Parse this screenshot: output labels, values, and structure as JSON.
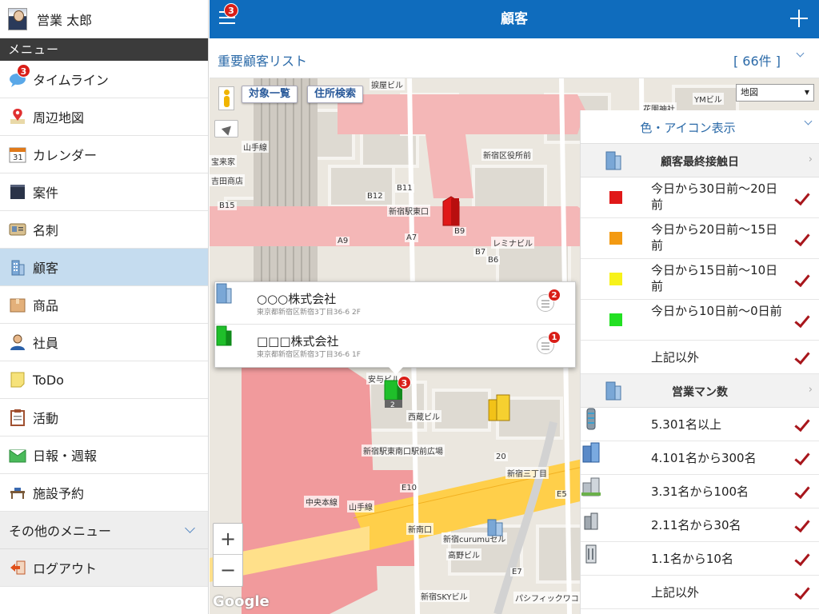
{
  "user": {
    "name": "営業 太郎"
  },
  "sidebar": {
    "menu_header": "メニュー",
    "items": [
      {
        "label": "タイムライン",
        "badge": "3",
        "icon": "chat-bubble-icon"
      },
      {
        "label": "周辺地図",
        "icon": "map-pin-icon"
      },
      {
        "label": "カレンダー",
        "icon": "calendar-icon"
      },
      {
        "label": "案件",
        "icon": "case-icon"
      },
      {
        "label": "名刺",
        "icon": "business-card-icon"
      },
      {
        "label": "顧客",
        "icon": "building-icon",
        "active": true
      },
      {
        "label": "商品",
        "icon": "box-icon"
      },
      {
        "label": "社員",
        "icon": "person-icon"
      },
      {
        "label": "ToDo",
        "icon": "note-icon"
      },
      {
        "label": "活動",
        "icon": "clipboard-icon"
      },
      {
        "label": "日報・週報",
        "icon": "report-icon"
      },
      {
        "label": "施設予約",
        "icon": "facility-icon"
      }
    ],
    "more_menu": "その他のメニュー",
    "logout": "ログアウト"
  },
  "header": {
    "title": "顧客",
    "badge": "3"
  },
  "subheader": {
    "list_name": "重要顧客リスト",
    "count": "[ 66件 ]"
  },
  "map": {
    "buttons": {
      "target_list": "対象一覧",
      "address_search": "住所検索"
    },
    "map_type": "地図",
    "zoom_in": "+",
    "zoom_out": "−",
    "attribution": "Google",
    "labels": {
      "l1": "新宿区役所前",
      "l2": "新宿駅東口",
      "l3": "レミナビル",
      "l4": "山手線",
      "l5": "宝来家",
      "l6": "吉田商店",
      "l7": "新宿駅東南口駅前広場",
      "l8": "新宿三丁目",
      "l9": "中央本線",
      "l10": "山手線",
      "l11": "新南口",
      "l12": "新宿curumuセル",
      "l13": "高野ビル",
      "l14": "新宿SKYビル",
      "l15": "パシフィックワコ",
      "l16": "西蔵ビル",
      "l17": "安与ビル",
      "l18": "YMビル",
      "l19": "花園神社",
      "l20": "捩屋ビル",
      "l21": "B12",
      "l22": "B11",
      "l23": "B15",
      "l24": "A9",
      "l25": "A7",
      "l26": "B9",
      "l27": "B7",
      "l28": "B6",
      "l29": "E10",
      "l30": "E5",
      "l31": "E7",
      "l32": "20",
      "l33": "2"
    },
    "marker_badge": "3",
    "popup": [
      {
        "name": "○○○株式会社",
        "address": "東京都新宿区新宿3丁目36-6 2F",
        "badge": "2",
        "color": "#7aa7d6"
      },
      {
        "name": "□□□株式会社",
        "address": "東京都新宿区新宿3丁目36-6 1F",
        "badge": "1",
        "color": "#1fbf2a"
      }
    ]
  },
  "legend": {
    "title": "色・アイコン表示",
    "section1": {
      "title": "顧客最終接触日",
      "rows": [
        {
          "label": "今日から30日前〜20日前",
          "color": "#e01818"
        },
        {
          "label": "今日から20日前〜15日前",
          "color": "#f39a12"
        },
        {
          "label": "今日から15日前〜10日前",
          "color": "#f7f21a"
        },
        {
          "label": "今日から10日前〜0日前",
          "color": "#22e022"
        },
        {
          "label": "上記以外"
        }
      ]
    },
    "section2": {
      "title": "営業マン数",
      "rows": [
        {
          "label": "5.301名以上",
          "icon": "tower-building-icon"
        },
        {
          "label": "4.101名から300名",
          "icon": "large-building-icon"
        },
        {
          "label": "3.31名から100名",
          "icon": "medium-building-icon"
        },
        {
          "label": "2.11名から30名",
          "icon": "small-building-icon"
        },
        {
          "label": "1.1名から10名",
          "icon": "tiny-building-icon"
        },
        {
          "label": "上記以外"
        }
      ]
    }
  }
}
